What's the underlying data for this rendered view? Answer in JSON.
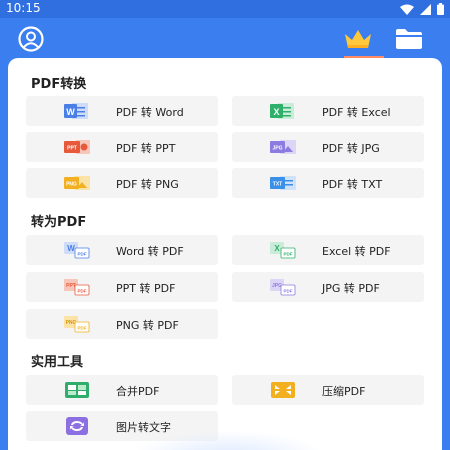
{
  "status_bar": {
    "time": "10:15"
  },
  "sections": [
    {
      "title": "PDF转换",
      "items": [
        {
          "label": "PDF 转 Word",
          "icon": "word-icon"
        },
        {
          "label": "PDF 转 Excel",
          "icon": "excel-icon"
        },
        {
          "label": "PDF 转 PPT",
          "icon": "ppt-icon"
        },
        {
          "label": "PDF 转 JPG",
          "icon": "jpg-icon"
        },
        {
          "label": "PDF 转 PNG",
          "icon": "png-icon"
        },
        {
          "label": "PDF 转 TXT",
          "icon": "txt-icon"
        }
      ]
    },
    {
      "title": "转为PDF",
      "items": [
        {
          "label": "Word 转 PDF",
          "icon": "word-to-pdf-icon"
        },
        {
          "label": "Excel 转 PDF",
          "icon": "excel-to-pdf-icon"
        },
        {
          "label": "PPT 转 PDF",
          "icon": "ppt-to-pdf-icon"
        },
        {
          "label": "JPG 转 PDF",
          "icon": "jpg-to-pdf-icon"
        },
        {
          "label": "PNG 转 PDF",
          "icon": "png-to-pdf-icon"
        }
      ]
    },
    {
      "title": "实用工具",
      "items": [
        {
          "label": "合并PDF",
          "icon": "merge-pdf-icon"
        },
        {
          "label": "压缩PDF",
          "icon": "compress-pdf-icon"
        },
        {
          "label": "图片转文字",
          "icon": "ocr-icon"
        }
      ]
    }
  ],
  "icon_badges": {
    "word": "W",
    "excel": "X",
    "ppt": "PPT",
    "jpg": "JPG",
    "png": "PNG",
    "txt": "TXT",
    "pdf": "PDF"
  },
  "colors": {
    "header_blue": "#3b7ef0",
    "word": "#4a7fe6",
    "excel": "#2eaf6a",
    "ppt": "#e8593c",
    "jpg": "#8c7be0",
    "png": "#f2b021",
    "txt": "#3a8fe8",
    "merge": "#2fae6b",
    "compress": "#f2b021",
    "ocr": "#8c6fe0",
    "crown": "#ffc83d"
  }
}
